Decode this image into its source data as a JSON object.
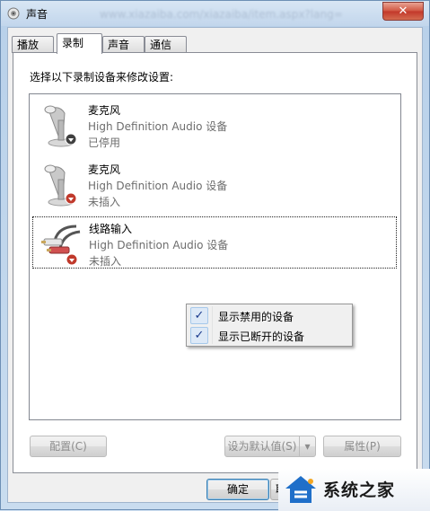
{
  "window": {
    "title": "声音",
    "address_blur": "www.xiazaiba.com/xiazaiba/item.aspx?lang=",
    "close_label": "✕"
  },
  "tabs": [
    {
      "label": "播放",
      "active": false
    },
    {
      "label": "录制",
      "active": true
    },
    {
      "label": "声音",
      "active": false
    },
    {
      "label": "通信",
      "active": false
    }
  ],
  "recording": {
    "instructions": "选择以下录制设备来修改设置:",
    "devices": [
      {
        "name": "麦克风",
        "description": "High Definition Audio 设备",
        "status": "已停用",
        "icon": "microphone-icon",
        "badge": "disabled-badge-icon"
      },
      {
        "name": "麦克风",
        "description": "High Definition Audio 设备",
        "status": "未插入",
        "icon": "microphone-icon",
        "badge": "unplugged-badge-icon"
      },
      {
        "name": "线路输入",
        "description": "High Definition Audio 设备",
        "status": "未插入",
        "icon": "line-in-cable-icon",
        "badge": "unplugged-badge-icon",
        "selected": true
      }
    ]
  },
  "context_menu": {
    "items": [
      {
        "label": "显示禁用的设备",
        "checked": true
      },
      {
        "label": "显示已断开的设备",
        "checked": true
      }
    ],
    "check_glyph": "✓"
  },
  "buttons": {
    "configure": "配置(C)",
    "set_default": "设为默认值(S)",
    "dropdown_arrow": "▾",
    "properties": "属性(P)",
    "ok": "确定",
    "cancel": "取"
  },
  "watermark": {
    "text": "系统之家"
  },
  "colors": {
    "badge_red": "#c0392b",
    "badge_dark": "#404040",
    "check_blue": "#1b3a8c"
  }
}
